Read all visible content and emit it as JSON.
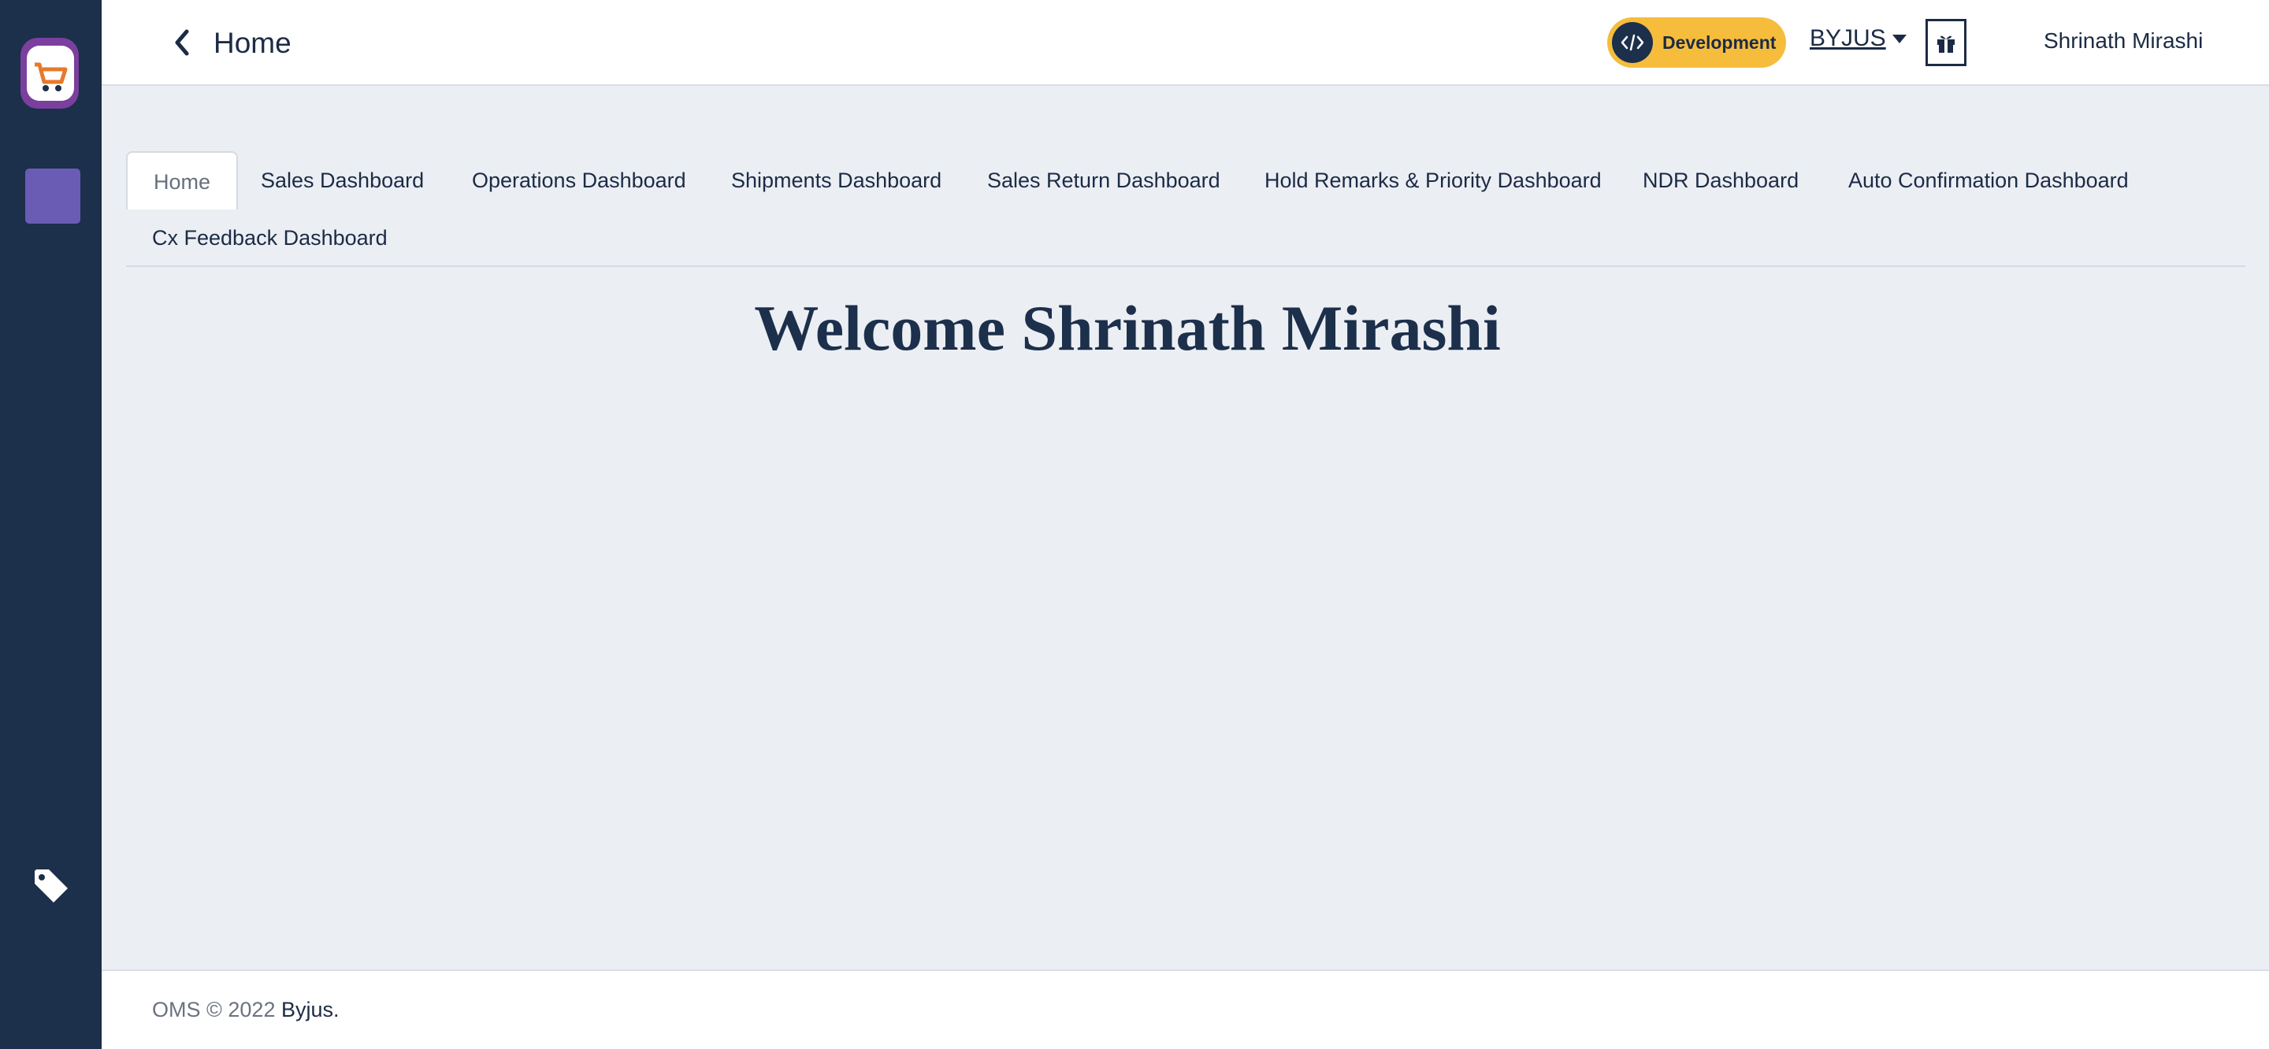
{
  "header": {
    "title": "Home",
    "environment": "Development",
    "organization": "BYJUS",
    "user_name": "Shrinath Mirashi"
  },
  "tabs": [
    {
      "label": "Home",
      "active": true
    },
    {
      "label": "Sales Dashboard",
      "active": false
    },
    {
      "label": "Operations Dashboard",
      "active": false
    },
    {
      "label": "Shipments Dashboard",
      "active": false
    },
    {
      "label": "Sales Return Dashboard",
      "active": false
    },
    {
      "label": "Hold Remarks & Priority Dashboard",
      "active": false
    },
    {
      "label": "NDR Dashboard",
      "active": false
    },
    {
      "label": "Auto Confirmation Dashboard",
      "active": false
    },
    {
      "label": "Cx Feedback Dashboard",
      "active": false
    }
  ],
  "main": {
    "welcome_text": "Welcome Shrinath Mirashi"
  },
  "footer": {
    "prefix": "OMS © 2022 ",
    "link": "Byjus."
  },
  "colors": {
    "sidebar": "#1c2f4b",
    "accent": "#6a5bb5",
    "badge": "#f6bd3c",
    "background": "#ebeef3"
  },
  "icons": [
    "app-logo-icon",
    "tag-icon",
    "back-arrow-icon",
    "code-icon",
    "caret-down-icon",
    "gift-icon"
  ]
}
